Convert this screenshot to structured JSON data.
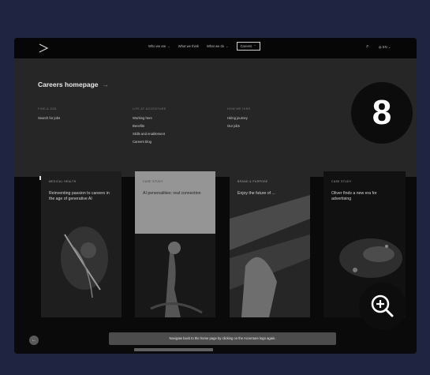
{
  "topbar": {
    "nav_items": [
      {
        "label": "Who we are",
        "has_chevron": true
      },
      {
        "label": "What we think",
        "has_chevron": false
      },
      {
        "label": "What we do",
        "has_chevron": true
      },
      {
        "label": "Careers",
        "has_chevron": true,
        "selected": true
      }
    ],
    "search_icon": "search-icon",
    "language": "EN"
  },
  "dropdown": {
    "title": "Careers homepage",
    "title_arrow": "→",
    "columns": [
      {
        "heading": "FIND A JOB",
        "links": [
          "Search for jobs"
        ]
      },
      {
        "heading": "LIFE AT ACCENTURE",
        "links": [
          "Working here",
          "Benefits",
          "Skills and enablement",
          "Careers blog"
        ]
      },
      {
        "heading": "HOW WE HIRE",
        "links": [
          "Hiring journey",
          "Our jobs"
        ]
      }
    ]
  },
  "step_badge": "8",
  "cards": [
    {
      "tag": "MEDICAL HEALTH",
      "title": "Reinventing passion to careers in the age of generative AI",
      "image": "person-with-lights-photo"
    },
    {
      "tag": "CASE STUDY",
      "title": "AI personalities: real connection",
      "image": "figure-portrait-photo",
      "highlight": true
    },
    {
      "tag": "BRAND & PURPOSE",
      "title": "Enjoy the future of ...",
      "image": "architecture-photo"
    },
    {
      "tag": "CASE STUDY",
      "title": "Oliver finds a new era for advertising",
      "image": "abstract-particles-photo"
    }
  ],
  "tooltip": "Navigate back to the home page by clicking on the Accenture logo again.",
  "back_label": "←",
  "zoom_icon": "zoom-in-icon",
  "colors": {
    "page_bg": "#1f2540",
    "frame_bg": "#0a0a0a",
    "dropdown_bg": "#262626",
    "highlight_card": "#959595"
  }
}
